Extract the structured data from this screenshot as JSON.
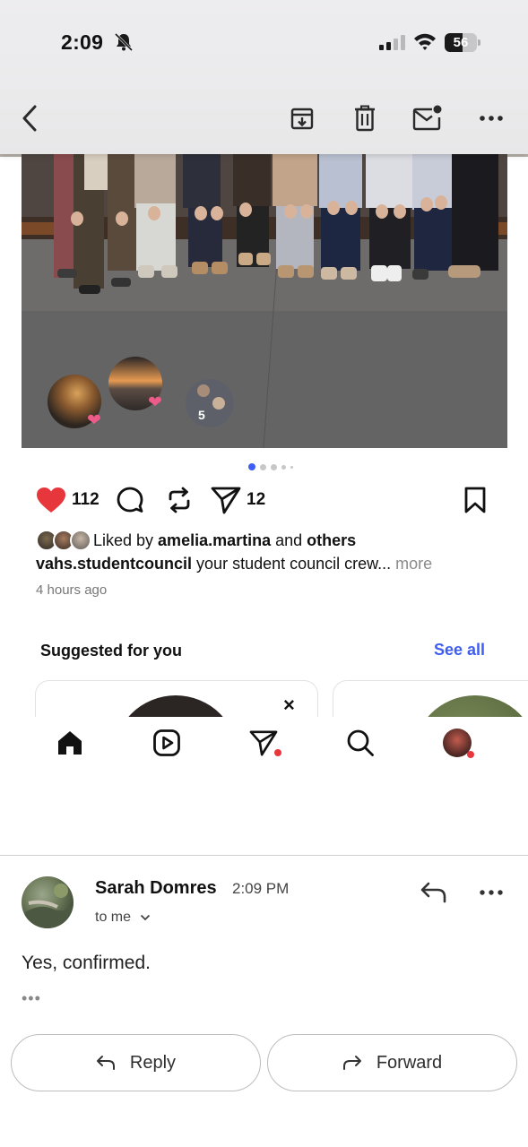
{
  "status_bar": {
    "time": "2:09",
    "battery_percent": "56",
    "battery_level": 0.56,
    "signal_bars_active": 2,
    "icons": [
      "bell-slash-icon",
      "cellular-signal-icon",
      "wifi-icon",
      "battery-icon"
    ]
  },
  "toolbar": {
    "icons": [
      "back-chevron-icon",
      "archive-icon",
      "trash-icon",
      "mark-unread-icon",
      "more-icon"
    ]
  },
  "post": {
    "reaction_overlay_count": "5",
    "carousel": {
      "total": 5,
      "active_index": 0
    },
    "likes": "112",
    "shares": "12",
    "liked_by_prefix": "Liked by ",
    "liked_by_user": "amelia.martina",
    "liked_by_joiner": " and ",
    "liked_by_others": "others",
    "caption_user": "vahs.studentcouncil",
    "caption_text": " your student council crew... ",
    "caption_more": "more",
    "time_ago": "4 hours ago",
    "like_color": "#e8363d",
    "icons": [
      "heart-icon",
      "comment-icon",
      "repost-icon",
      "send-icon",
      "bookmark-icon"
    ]
  },
  "suggested": {
    "title": "Suggested for you",
    "see_all": "See all",
    "dismiss_symbol": "×"
  },
  "tabs": {
    "icons": [
      "home-icon",
      "reels-icon",
      "messages-icon",
      "search-icon",
      "profile-icon"
    ]
  },
  "email": {
    "sender": "Sarah Domres",
    "time": "2:09 PM",
    "recipient": "to me",
    "body": "Yes, confirmed.",
    "trimmed_indicator": "•••",
    "reply_label": "Reply",
    "forward_label": "Forward",
    "accent_color": "#3f5df0"
  }
}
